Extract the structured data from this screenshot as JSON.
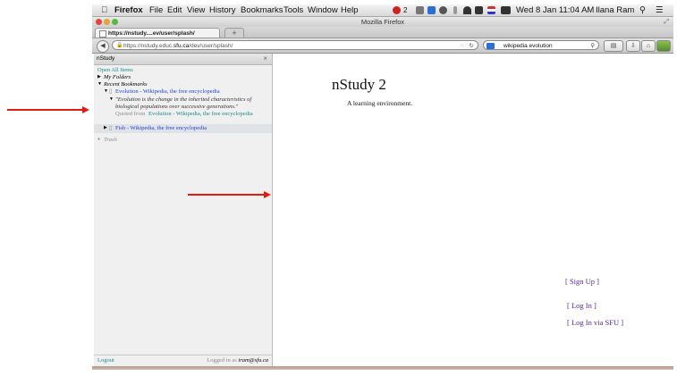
{
  "menubar": {
    "app": "Firefox",
    "items": [
      "File",
      "Edit",
      "View",
      "History",
      "Bookmarks",
      "Tools",
      "Window",
      "Help"
    ],
    "status_count": "2",
    "datetime": "Wed 8 Jan  11:04 AM",
    "user": "Ilana Ram"
  },
  "window": {
    "title": "Mozilla Firefox"
  },
  "tabs": {
    "active_label": "https://nstudy....ev/user/splash/",
    "new_tab": "+"
  },
  "navbar": {
    "url_prefix": "https://nstudy.educ.",
    "url_domain": "sfu.ca",
    "url_suffix": "/dev/user/splash/",
    "search_value": "wikipedia evolution"
  },
  "sidebar": {
    "title": "nStudy",
    "close": "×",
    "open_all": "Open All Items",
    "my_folders": "My Folders",
    "recent_bookmarks": "Recent Bookmarks",
    "bookmark1": "Evolution - Wikipedia, the free encyclopedia",
    "quote_line1": "\"Evolution is the change in the inherited characteristics of",
    "quote_line2": "biological populations over successive generations.\"",
    "quoted_from_label": "Quoted from",
    "quoted_from_source": "Evolution - Wikipedia, the free encyclopedia",
    "bookmark2": "Fish - Wikipedia, the free encyclopedia",
    "trash": "Trash",
    "logout": "Logout",
    "logged_in_prefix": "Logged in as",
    "logged_in_user": "iram@sfu.ca"
  },
  "main": {
    "title": "nStudy 2",
    "subtitle": "A learning environment.",
    "sign_up": "[ Sign Up ]",
    "log_in": "[ Log In ]",
    "log_in_sfu": "[ Log In via SFU ]"
  },
  "colors": {
    "annotation_arrow": "#e21b12",
    "link_teal": "#1a8a8a",
    "link_blue": "#2244cc",
    "link_purple": "#5a2a9a"
  }
}
